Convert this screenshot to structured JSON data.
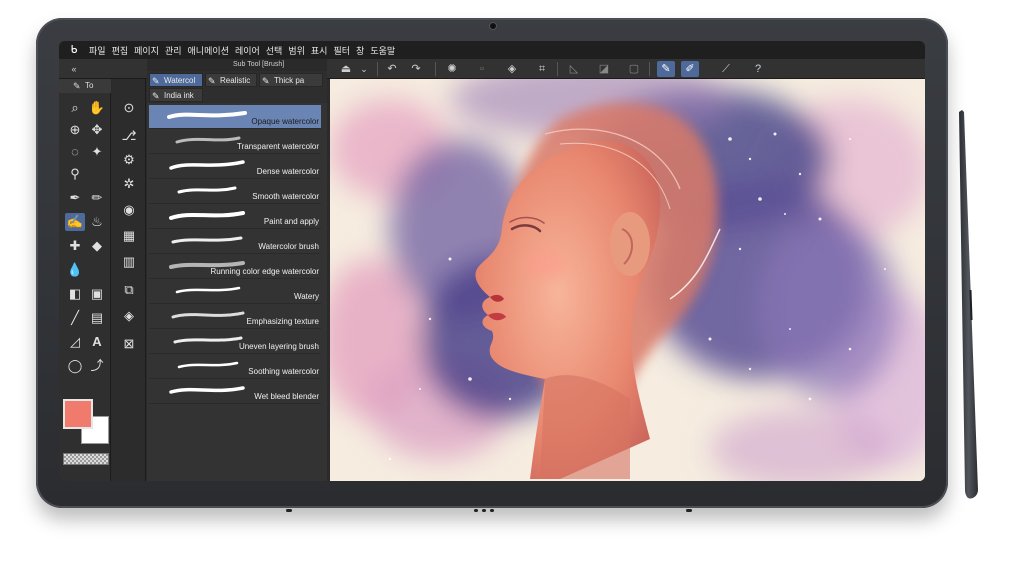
{
  "menu": {
    "items": [
      "파일",
      "편집",
      "페이지",
      "관리",
      "애니메이션",
      "레이어",
      "선택",
      "범위",
      "표시",
      "필터",
      "창",
      "도움말"
    ]
  },
  "tool_panel": {
    "tab_label": "To"
  },
  "sub_tool": {
    "title": "Sub Tool [Brush]",
    "tabs": [
      "Watercol",
      "Realistic",
      "Thick pa",
      "India ink"
    ],
    "brushes": [
      "Opaque watercolor",
      "Transparent watercolor",
      "Dense watercolor",
      "Smooth watercolor",
      "Paint and apply",
      "Watercolor brush",
      "Running color edge watercolor",
      "Watery",
      "Emphasizing texture",
      "Uneven layering brush",
      "Soothing watercolor",
      "Wet bleed blender"
    ],
    "selected_index": 0
  },
  "colors": {
    "main_color": "#f07a6c",
    "sub_color": "#ffffff",
    "accent": "#4e6a9a"
  },
  "icons": {
    "toolbar": [
      "canvas-icon",
      "chevron-down-icon",
      "undo-icon",
      "redo-icon",
      "loading-icon",
      "clear-icon",
      "fill-icon",
      "crop-icon",
      "transform-icon",
      "mask-icon",
      "frame-icon",
      "brush-draw-icon",
      "pen-draw-icon",
      "line-icon",
      "help-icon"
    ]
  }
}
